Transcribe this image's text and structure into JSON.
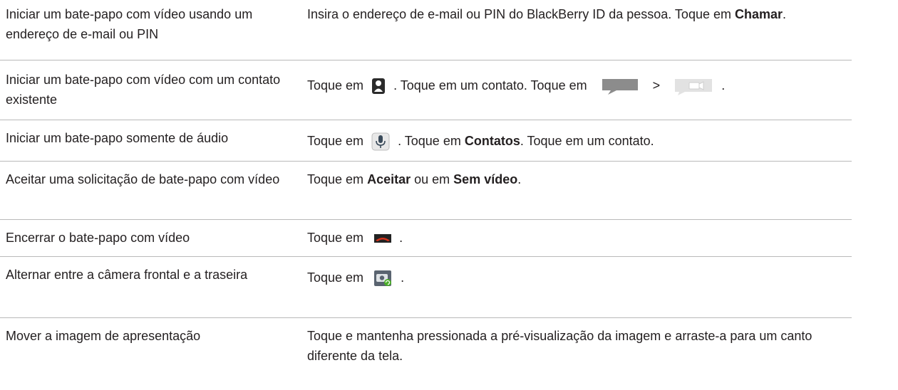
{
  "rows": [
    {
      "task": "Iniciar um bate-papo com vídeo usando um endereço de e-mail ou PIN",
      "instruction": {
        "text_1": "Insira o endereço de e-mail ou PIN do BlackBerry ID da pessoa. Toque em",
        "bold_1": "Chamar",
        "text_2": "."
      }
    },
    {
      "task": "Iniciar um bate-papo com vídeo com um contato existente",
      "instruction": {
        "text_1": "Toque em",
        "text_2": ". Toque em um contato. Toque em",
        "separator": ">",
        "text_3": "."
      },
      "icons": [
        "contact-icon",
        "chat-bubble-icon",
        "video-camera-icon"
      ]
    },
    {
      "task": "Iniciar um bate-papo somente de áudio",
      "instruction": {
        "text_1": "Toque em",
        "text_2": ". Toque em",
        "bold_1": "Contatos",
        "text_3": ". Toque em um contato."
      },
      "icons": [
        "microphone-icon"
      ]
    },
    {
      "task": "Aceitar uma solicitação de bate-papo com vídeo",
      "instruction": {
        "text_1": "Toque em",
        "bold_1": "Aceitar",
        "text_2": "ou em",
        "bold_2": "Sem vídeo",
        "text_3": "."
      }
    },
    {
      "task": "Encerrar o bate-papo com vídeo",
      "instruction": {
        "text_1": "Toque em",
        "text_2": "."
      },
      "icons": [
        "end-call-icon"
      ],
      "colors": {
        "end_call": "#d6321b"
      }
    },
    {
      "task": "Alternar entre a câmera frontal e a traseira",
      "instruction": {
        "text_1": "Toque em",
        "text_2": "."
      },
      "icons": [
        "switch-camera-icon"
      ],
      "colors": {
        "switch_arrow": "#4caf2a"
      }
    },
    {
      "task": "Mover a imagem de apresentação",
      "instruction": {
        "text_1": "Toque e mantenha pressionada a pré-visualização da imagem e arraste-a para um canto diferente da tela."
      }
    }
  ]
}
